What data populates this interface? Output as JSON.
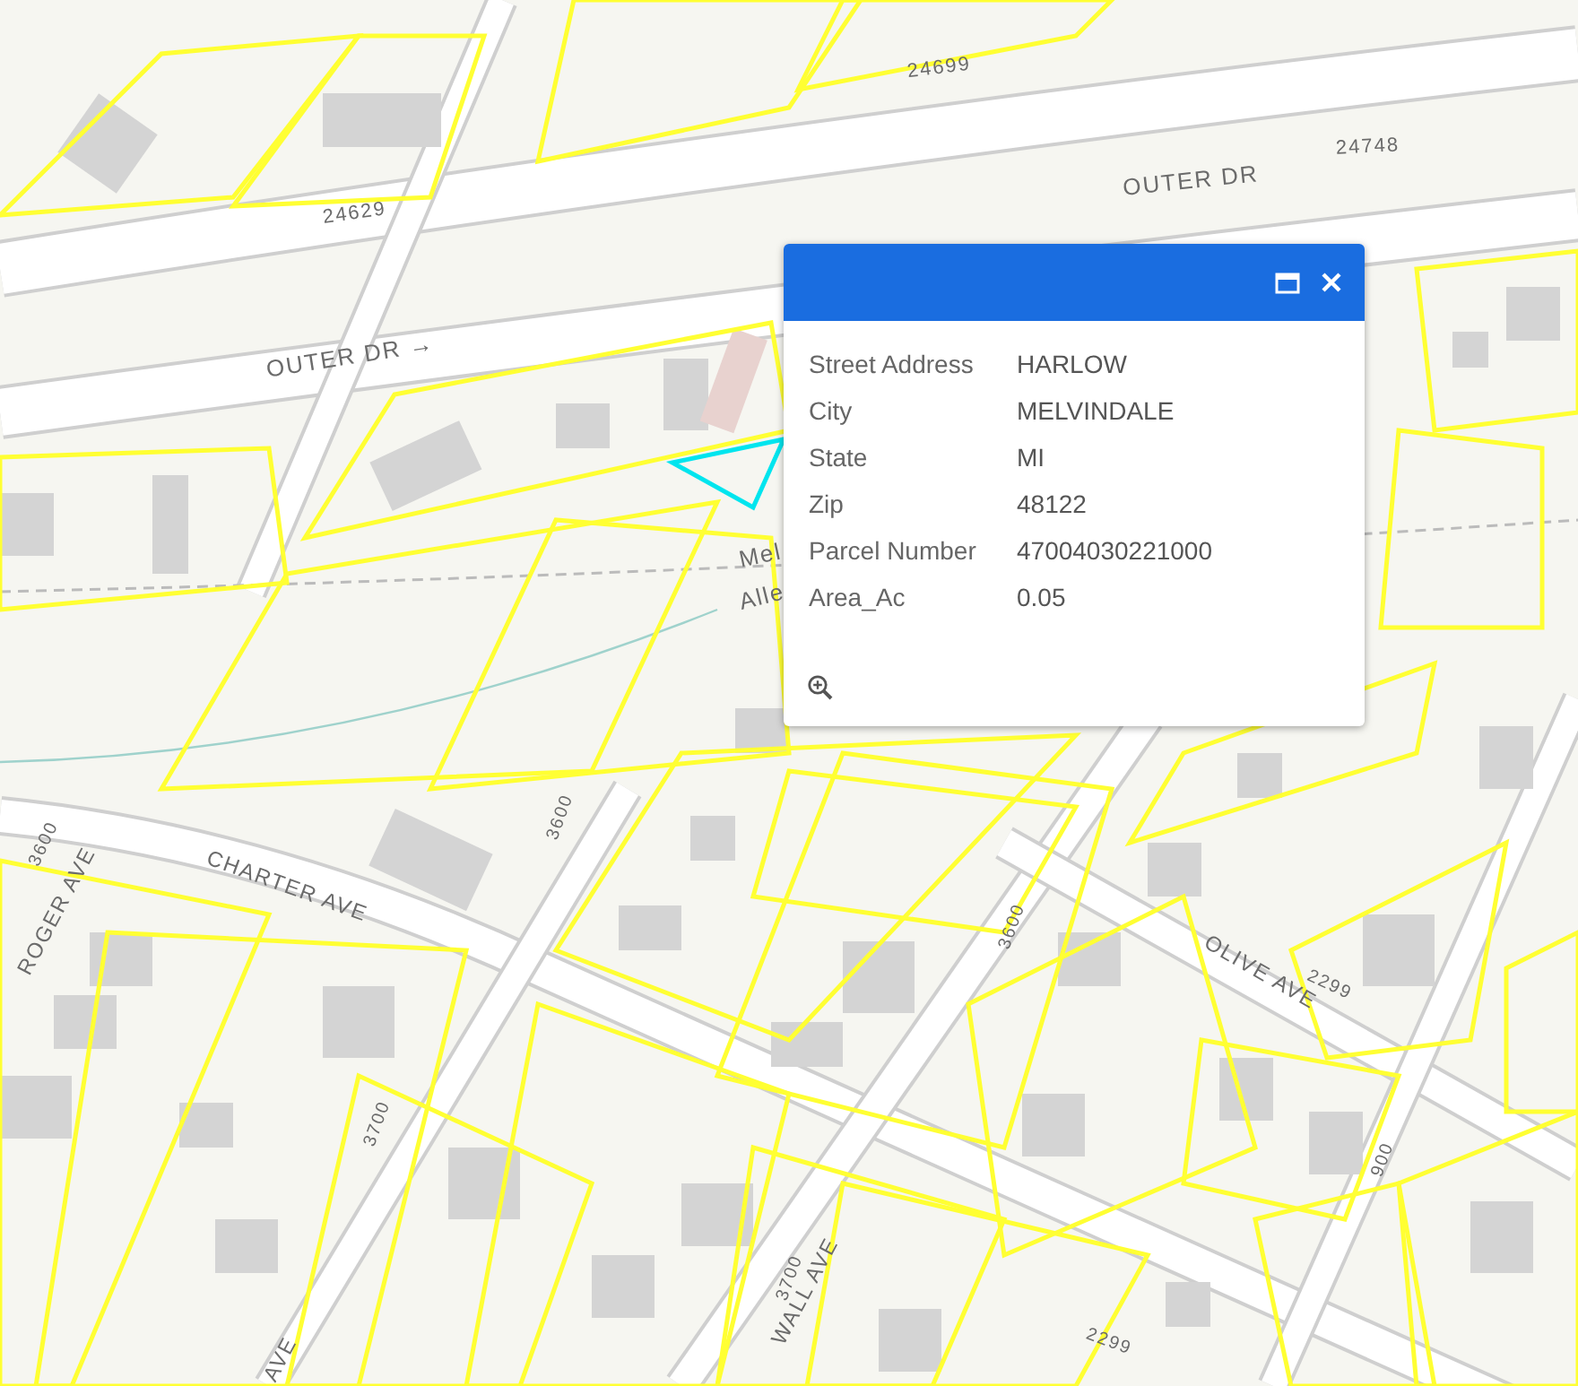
{
  "map": {
    "street_labels": [
      {
        "text": "24699"
      },
      {
        "text": "24748"
      },
      {
        "text": "OUTER DR"
      },
      {
        "text": "24629"
      },
      {
        "text": "OUTER DR →"
      },
      {
        "text": "Mel"
      },
      {
        "text": "Alle"
      },
      {
        "text": "3600"
      },
      {
        "text": "ROGER AVE"
      },
      {
        "text": "CHARTER AVE"
      },
      {
        "text": "3600"
      },
      {
        "text": "3600"
      },
      {
        "text": "OLIVE AVE"
      },
      {
        "text": "2299"
      },
      {
        "text": "3700"
      },
      {
        "text": "900"
      },
      {
        "text": "3700"
      },
      {
        "text": "WALL AVE"
      },
      {
        "text": "AVE"
      },
      {
        "text": "2299"
      }
    ]
  },
  "popup": {
    "fields": [
      {
        "label": "Street Address",
        "value": "HARLOW"
      },
      {
        "label": "City",
        "value": "MELVINDALE"
      },
      {
        "label": "State",
        "value": "MI"
      },
      {
        "label": "Zip",
        "value": "48122"
      },
      {
        "label": "Parcel Number",
        "value": "47004030221000"
      },
      {
        "label": "Area_Ac",
        "value": "0.05"
      }
    ]
  }
}
